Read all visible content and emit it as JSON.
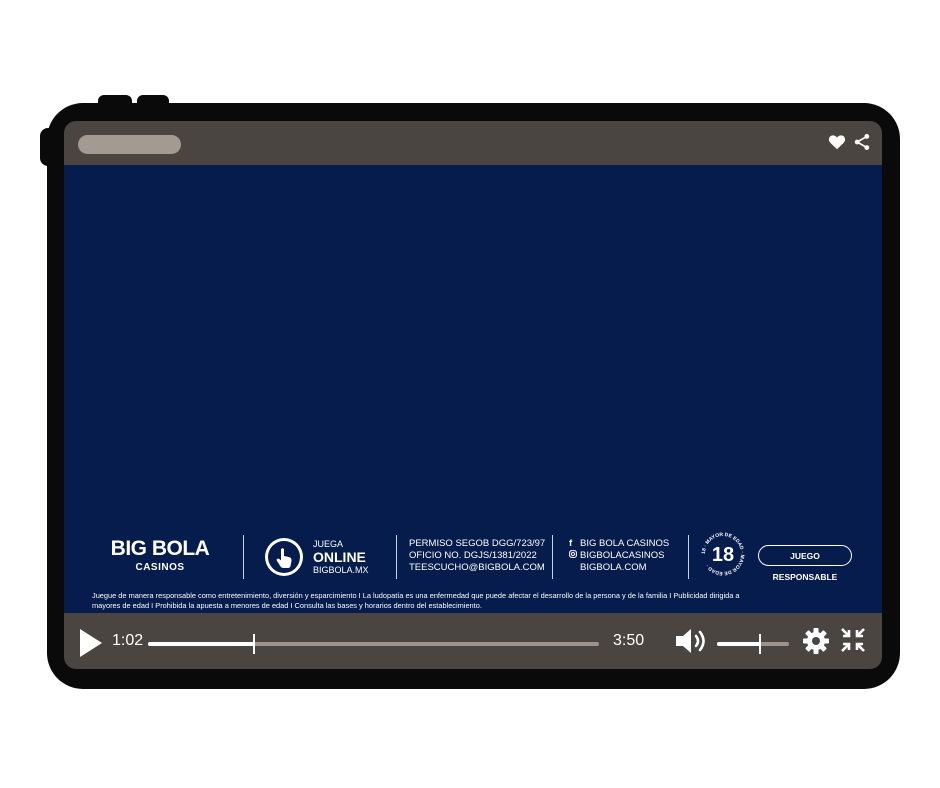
{
  "player": {
    "title": "",
    "current_time": "1:02",
    "total_time": "3:50",
    "progress": 0.235,
    "volume": 0.6
  },
  "icons": {
    "like": "heart-icon",
    "share": "share-icon",
    "play": "play-icon",
    "volume": "volume-icon",
    "settings": "gear-icon",
    "fullscreen": "exit-fullscreen-icon",
    "online": "hand-pointer-icon",
    "facebook": "facebook-icon",
    "instagram": "instagram-icon"
  },
  "colors": {
    "video_background": "#051c4c",
    "player_chrome": "#4b4541",
    "accent": "#ffffff"
  },
  "ad": {
    "brand": {
      "logo_text": "BIG BOLA",
      "subtitle": "CASINOS"
    },
    "online": {
      "label_top": "JUEGA",
      "label_main": "ONLINE",
      "url": "BIGBOLA.MX"
    },
    "permits": [
      "PERMISO SEGOB DGG/723/97",
      "OFICIO NO. DGJS/1381/2022",
      "TEESCUCHO@BIGBOLA.COM"
    ],
    "social": [
      "BIG BOLA CASINOS",
      "BIGBOLACASINOS",
      "BIGBOLA.COM"
    ],
    "age": {
      "number": "18",
      "ring_text": "18 · MAYOR DE EDAD · MAYOR DE EDAD ·"
    },
    "responsible_button": "JUEGO RESPONSABLE",
    "disclaimer_line1": "Juegue de manera responsable como entretenimiento, diversión y esparcimiento I La ludopatía es una enfermedad que puede afectar el desarrollo de la persona y de la familia I Publicidad dirigida a",
    "disclaimer_line2": "mayores de edad I Prohibida la apuesta a menores de edad I Consulta las bases y horarios dentro del establecimiento."
  }
}
